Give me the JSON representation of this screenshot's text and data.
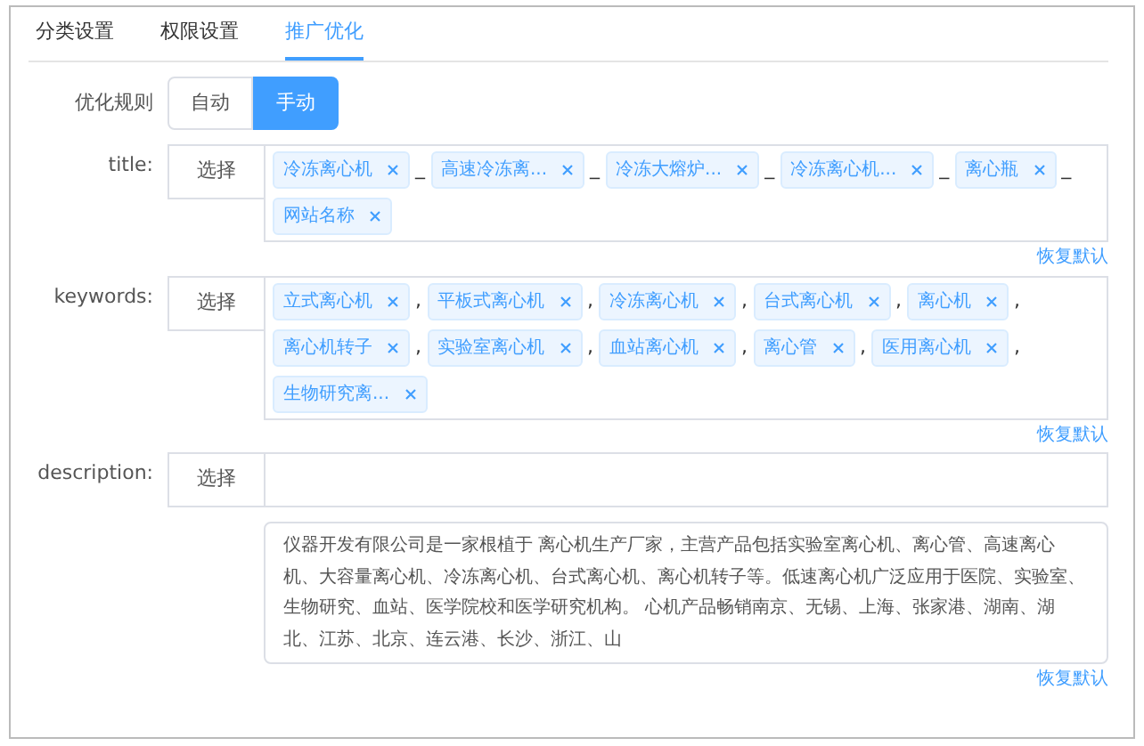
{
  "tabs": [
    {
      "label": "分类设置",
      "selected": false
    },
    {
      "label": "权限设置",
      "selected": false
    },
    {
      "label": "推广优化",
      "selected": true
    }
  ],
  "rule": {
    "label": "优化规则",
    "options": [
      {
        "label": "自动",
        "selected": false
      },
      {
        "label": "手动",
        "selected": true
      }
    ]
  },
  "fields": [
    {
      "kind": "tags",
      "label": "title:",
      "button": "选择",
      "separator": "_",
      "tags": [
        "冷冻离心机",
        "高速冷冻离...",
        "冷冻大熔炉...",
        "冷冻离心机...",
        "离心瓶",
        "网站名称"
      ],
      "restore": "恢复默认"
    },
    {
      "kind": "tags",
      "label": "keywords:",
      "button": "选择",
      "separator": ",",
      "tags": [
        "立式离心机",
        "平板式离心机",
        "冷冻离心机",
        "台式离心机",
        "离心机",
        "离心机转子",
        "实验室离心机",
        "血站离心机",
        "离心管",
        "医用离心机",
        "生物研究离..."
      ],
      "restore": "恢复默认"
    },
    {
      "kind": "text",
      "label": "description:",
      "button": "选择",
      "value": "仪器开发有限公司是一家根植于 离心机生产厂家，主营产品包括实验室离心机、离心管、高速离心机、大容量离心机、冷冻离心机、台式离心机、离心机转子等。低速离心机广泛应用于医院、实验室、生物研究、血站、医学院校和医学研究机构。 心机产品畅销南京、无锡、上海、张家港、湖南、湖北、江苏、北京、连云港、长沙、浙江、山",
      "restore": "恢复默认"
    }
  ]
}
